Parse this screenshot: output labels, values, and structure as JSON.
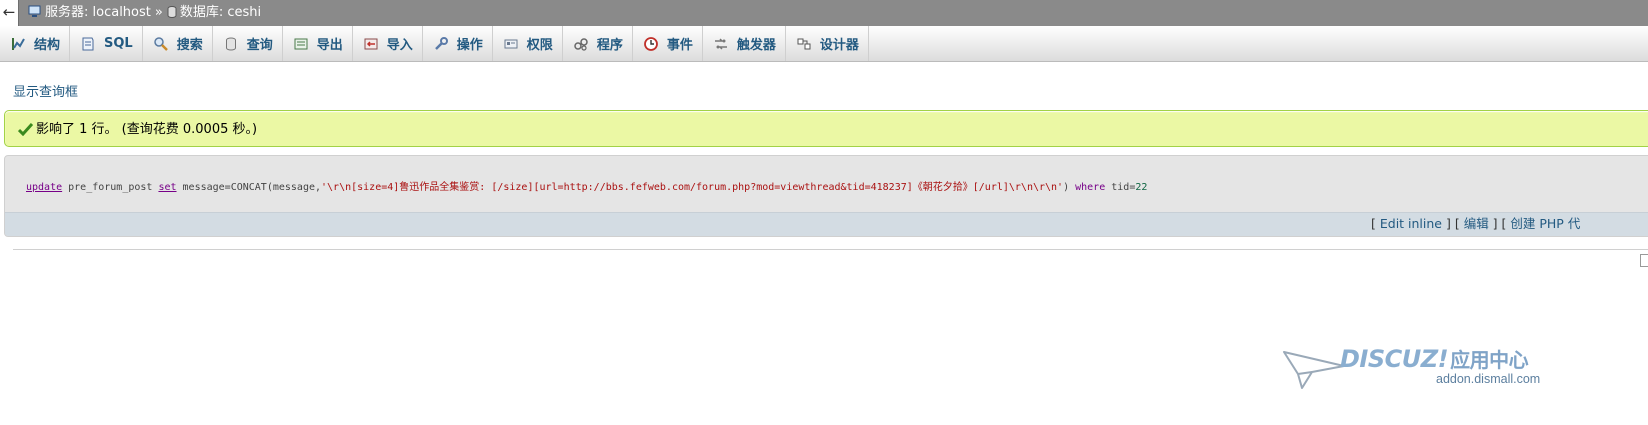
{
  "nav": {
    "back_glyph": "←",
    "server_label": "服务器: localhost",
    "separator": "»",
    "database_label": "数据库: ceshi"
  },
  "tabs": [
    {
      "label": "结构",
      "icon": "structure-icon"
    },
    {
      "label": "SQL",
      "icon": "sql-icon"
    },
    {
      "label": "搜索",
      "icon": "search-icon"
    },
    {
      "label": "查询",
      "icon": "query-icon"
    },
    {
      "label": "导出",
      "icon": "export-icon"
    },
    {
      "label": "导入",
      "icon": "import-icon"
    },
    {
      "label": "操作",
      "icon": "wrench-icon"
    },
    {
      "label": "权限",
      "icon": "privileges-icon"
    },
    {
      "label": "程序",
      "icon": "routines-icon"
    },
    {
      "label": "事件",
      "icon": "events-clock-icon"
    },
    {
      "label": "触发器",
      "icon": "triggers-icon"
    },
    {
      "label": "设计器",
      "icon": "designer-icon"
    }
  ],
  "show_query_link": "显示查询框",
  "success": {
    "icon": "checkmark-icon",
    "message": "影响了 1 行。 (查询花费 0.0005 秒。)"
  },
  "sql": {
    "kw_update": "update",
    "table": " pre_forum_post ",
    "kw_set": "set",
    "assign": " message=CONCAT(message,",
    "string": "'\\r\\n[size=4]鲁迅作品全集鉴赏: [/size][url=http://bbs.fefweb.com/forum.php?mod=viewthread&tid=418237]《朝花夕拾》[/url]\\r\\n\\r\\n'",
    "close": ") ",
    "kw_where": "where",
    "cond": " tid=",
    "num": "22"
  },
  "actions": {
    "open1": "[ ",
    "edit_inline": "Edit inline",
    "mid1": " ] [ ",
    "edit": "编辑",
    "mid2": " ] [ ",
    "create_php": "创建 PHP 代"
  },
  "watermark": {
    "brand": "DISCUZ!",
    "brand_cn": "应用中心",
    "domain": "addon.dismall.com"
  },
  "colors": {
    "topbar_bg": "#8a8a8a",
    "link": "#235a81",
    "success_bg": "#ebf8a4",
    "success_border": "#a2d246",
    "sql_string": "#aa1111",
    "sql_keyword": "#770088"
  }
}
